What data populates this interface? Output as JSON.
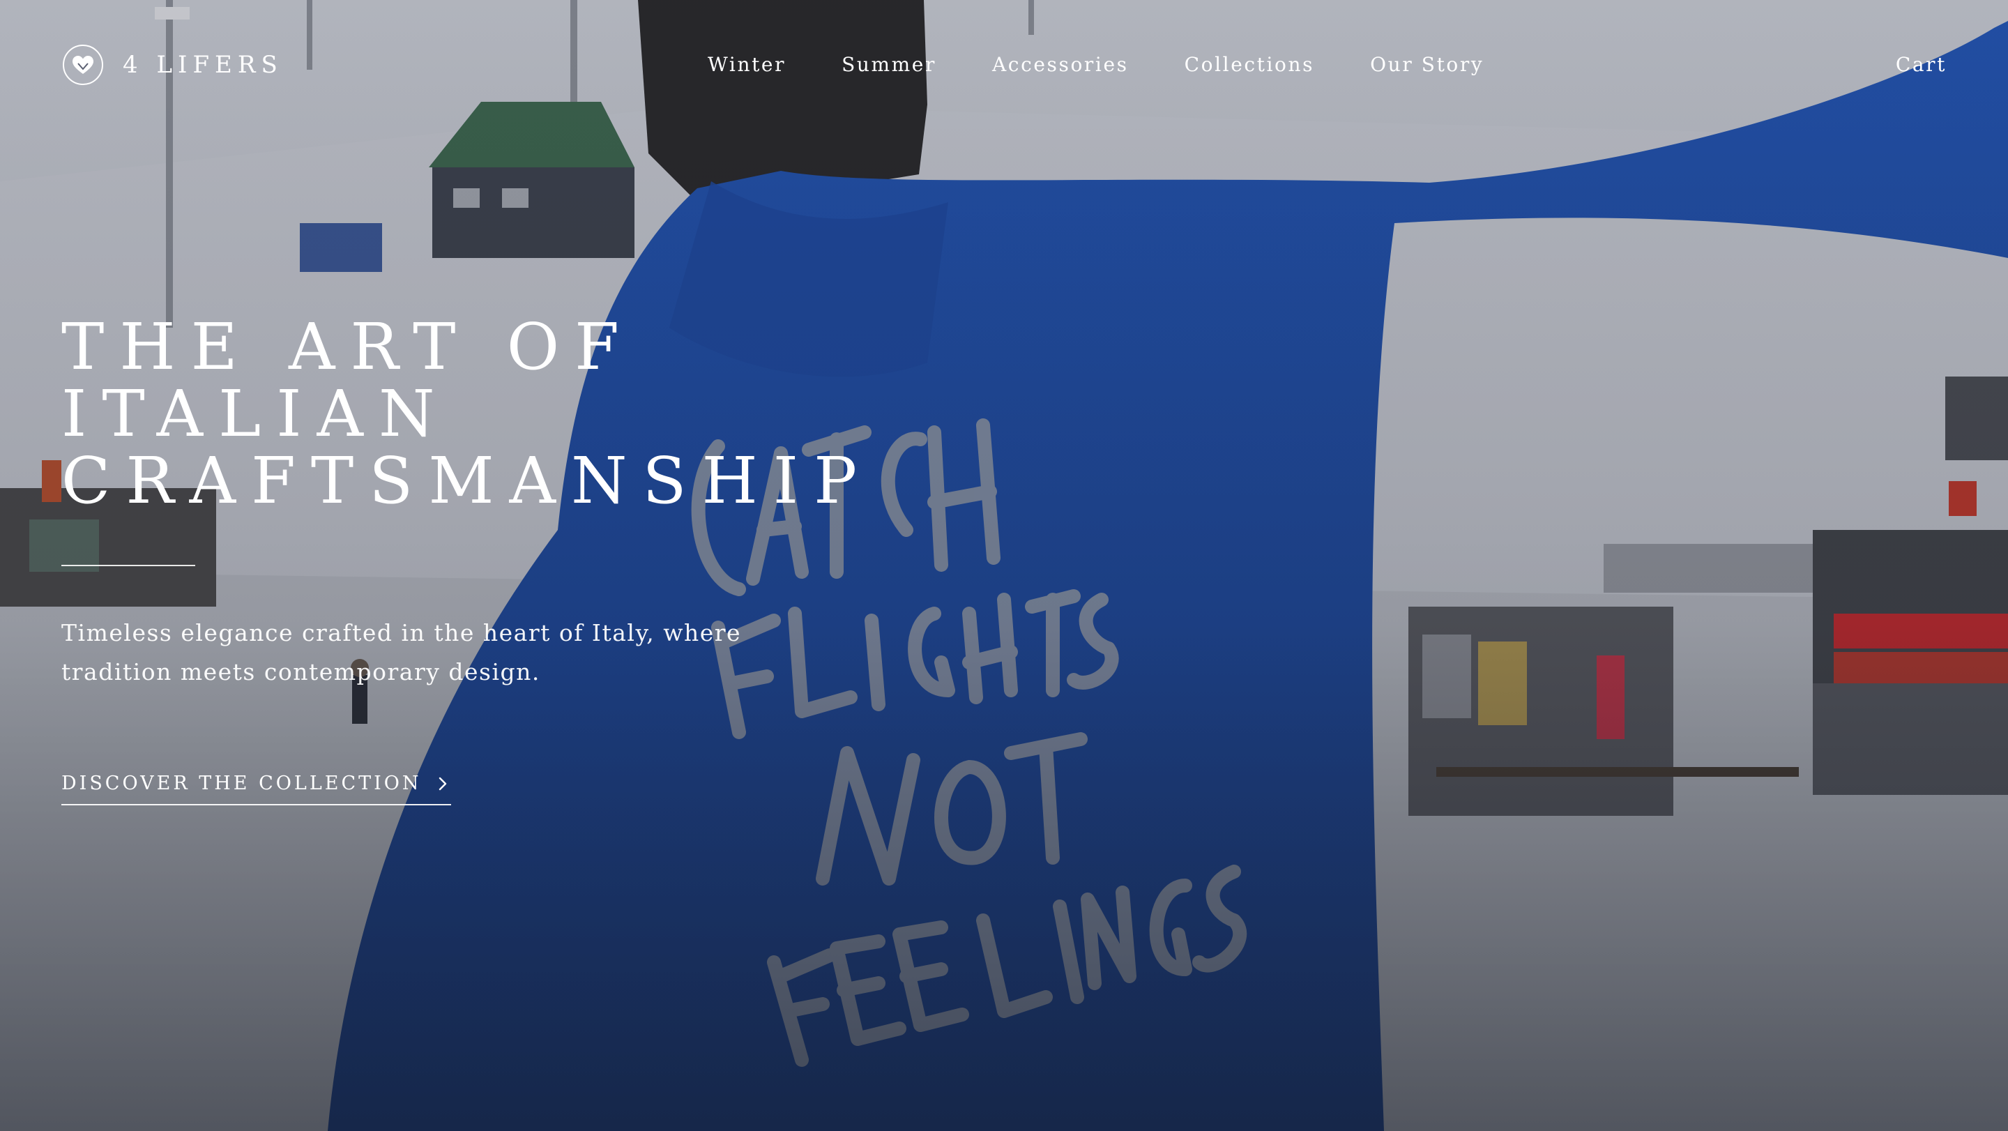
{
  "header": {
    "brand": "4 LIFERS",
    "nav": [
      {
        "label": "Winter"
      },
      {
        "label": "Summer"
      },
      {
        "label": "Accessories"
      },
      {
        "label": "Collections"
      },
      {
        "label": "Our Story"
      }
    ],
    "cart_label": "Cart",
    "logo_icon": "heart-in-circle-icon"
  },
  "hero": {
    "title_lines": [
      "THE ART OF",
      "ITALIAN",
      "CRAFTSMANSHIP"
    ],
    "subtitle_lines": [
      "Timeless elegance crafted in the heart of Italy, where",
      "tradition meets contemporary design."
    ],
    "cta_label": "DISCOVER THE COLLECTION",
    "cta_icon": "chevron-right-icon",
    "background_image": "ski-slope-person-blue-hoodie",
    "hoodie_print": [
      "CATCH",
      "FLIGHTS,",
      "NOT",
      "FEELINGS."
    ]
  },
  "colors": {
    "text": "#ffffff",
    "hoodie_blue": "#1f4fae",
    "hoodie_print": "#8e99ad",
    "snow": "#dcdde4",
    "overlay": "#141822"
  }
}
